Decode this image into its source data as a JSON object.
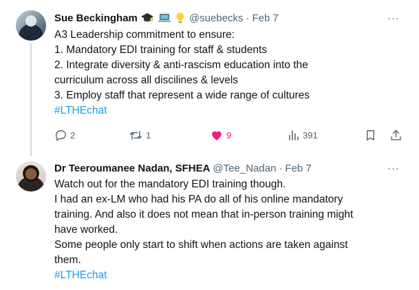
{
  "tweets": [
    {
      "display_name": "Sue Beckingham",
      "emojis": [
        "graduation-cap-icon",
        "laptop-icon",
        "lightbulb-icon"
      ],
      "handle": "@suebecks",
      "separator": "·",
      "date": "Feb 7",
      "more_label": "···",
      "lines": [
        "A3 Leadership commitment to ensure:",
        "1. Mandatory EDI training for staff & students",
        "2. Integrate diversity & anti-rascism education into the",
        "curriculum across all discilines & levels",
        "3. Employ staff that represent a wide range of cultures"
      ],
      "hashtag": "#LTHEchat",
      "actions": {
        "replies": "2",
        "retweets": "1",
        "likes": "9",
        "views": "391"
      }
    },
    {
      "display_name": "Dr Teeroumanee Nadan, SFHEA",
      "handle": "@Tee_Nadan",
      "separator": "·",
      "date": "Feb 7",
      "more_label": "···",
      "lines": [
        "Watch out for the mandatory EDI training though.",
        "I had an ex-LM who had his PA do all of his online mandatory",
        "training. And also it does not mean that in-person training might",
        "have worked.",
        "Some people only start to shift when actions are taken against",
        "them."
      ],
      "hashtag": "#LTHEchat"
    }
  ],
  "colors": {
    "text": "#0f1419",
    "secondary": "#536471",
    "link": "#1d9bf0",
    "like": "#f91880",
    "thread_line": "#cfd9de"
  }
}
